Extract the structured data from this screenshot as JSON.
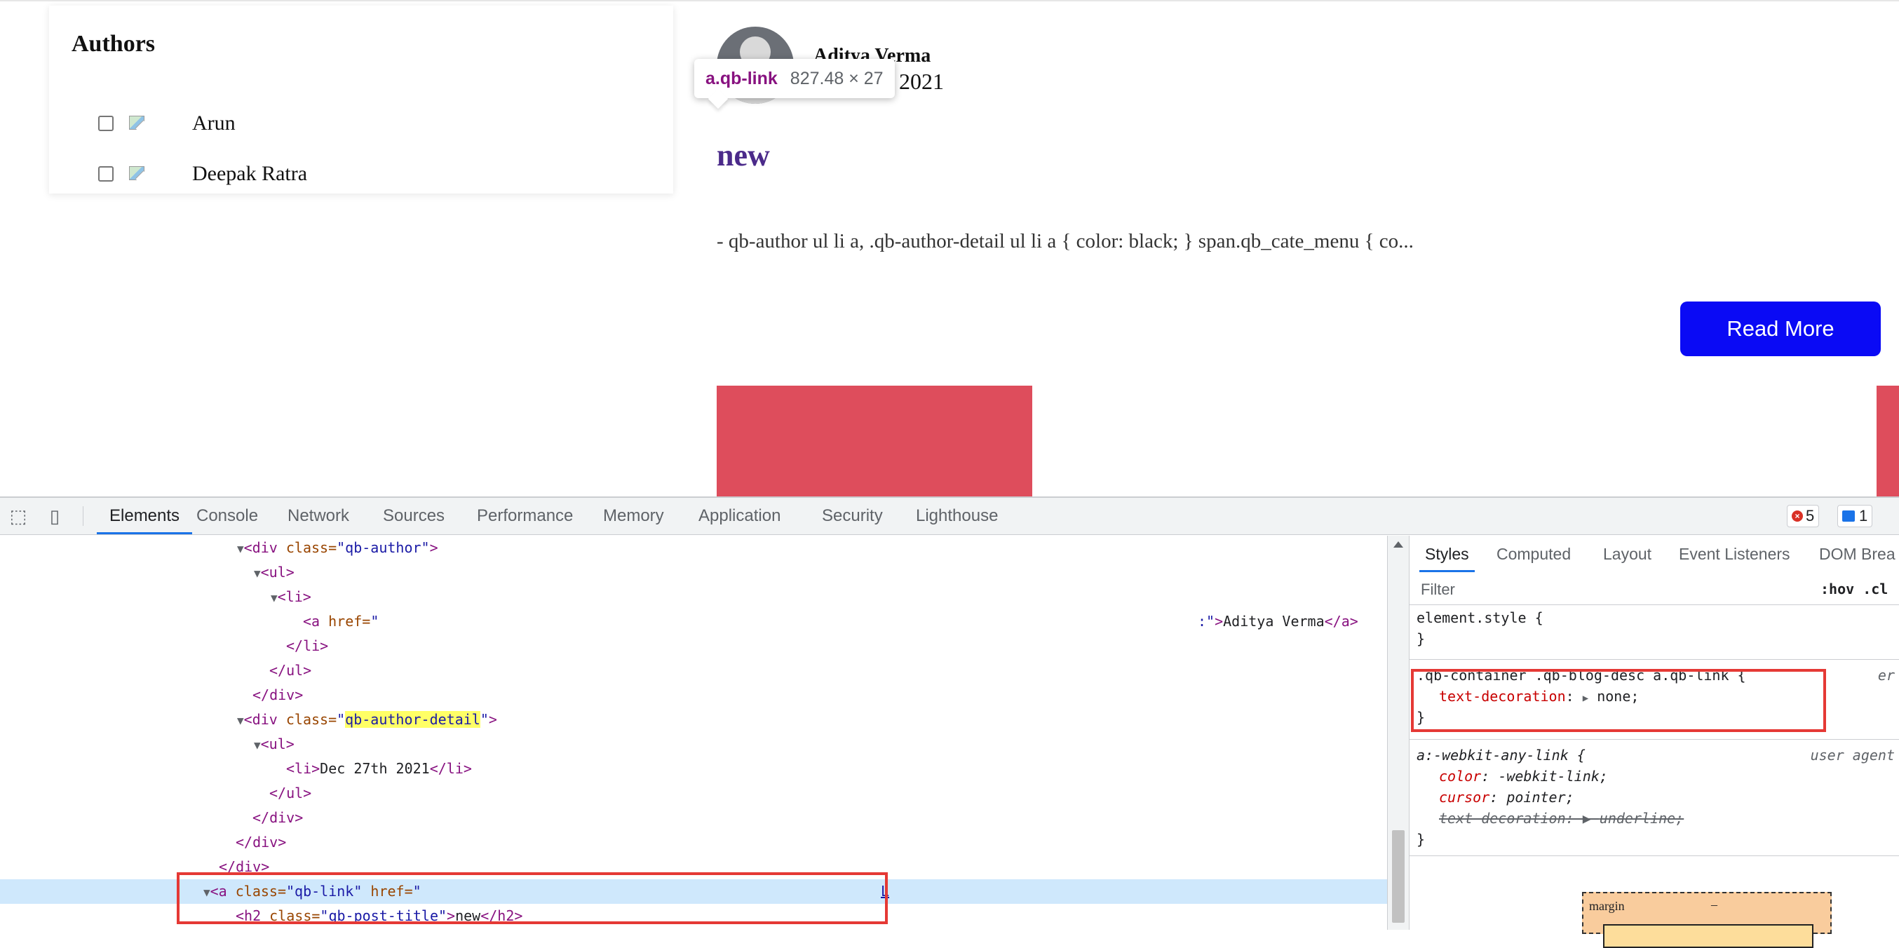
{
  "page": {
    "authors_title": "Authors",
    "authors": [
      {
        "name": "Arun"
      },
      {
        "name": "Deepak Ratra"
      }
    ],
    "post": {
      "author": "Aditya Verma",
      "date_fragment": "2021",
      "title": "new",
      "excerpt": "- qb-author ul li a, .qb-author-detail ul li a { color: black; } span.qb_cate_menu { co...",
      "read_more_label": "Read More",
      "thumb_color": "#de4d5c"
    },
    "tooltip": {
      "selector": "a.qb-link",
      "dimensions": "827.48 × 27"
    }
  },
  "devtools": {
    "tabs": [
      "Elements",
      "Console",
      "Network",
      "Sources",
      "Performance",
      "Memory",
      "Application",
      "Security",
      "Lighthouse"
    ],
    "active_tab": "Elements",
    "errors_count": "5",
    "messages_count": "1",
    "dom": {
      "l1_tag_open": "<div ",
      "l1_attr": "class=",
      "l1_val": "\"qb-author\"",
      "l1_close": ">",
      "l2": "<ul>",
      "l3": "<li>",
      "l4_tag": "<a ",
      "l4_attr": "href=",
      "l4_val": "\"",
      "l4_tail_val": ":\"",
      "l4_tail_close": ">",
      "l4_text": "Aditya Verma",
      "l4_end": "</a>",
      "l5": "</li>",
      "l6": "</ul>",
      "l7": "</div>",
      "l8_tag_open": "<div ",
      "l8_attr": "class=",
      "l8_val_q1": "\"",
      "l8_val_hl": "qb-author-detail",
      "l8_val_q2": "\"",
      "l8_close": ">",
      "l9": "<ul>",
      "l10_open": "<li>",
      "l10_text": "Dec 27th 2021",
      "l10_close": "</li>",
      "l11": "</ul>",
      "l12": "</div>",
      "l13": "</div>",
      "l14": "</div>",
      "l15_tag": "<a ",
      "l15_attr1": "class=",
      "l15_val1": "\"qb-link\"",
      "l15_attr2": " href=",
      "l15_val2": "\"",
      "l15_tail": "L",
      "l16_tag": "<h2 ",
      "l16_attr": "class=",
      "l16_val": "\"qb-post-title\"",
      "l16_close": ">",
      "l16_text": "new",
      "l16_end": "</h2>"
    },
    "styles": {
      "tabs": [
        "Styles",
        "Computed",
        "Layout",
        "Event Listeners",
        "DOM Brea"
      ],
      "active_tab": "Styles",
      "filter_placeholder": "Filter",
      "filter_options": ":hov .cl",
      "element_style_open": "element.style {",
      "close_brace": "}",
      "rule1_selector": ".qb-container .qb-blog-desc a.qb-link {",
      "rule1_source": "er",
      "rule1_prop": "text-decoration",
      "rule1_value": "none;",
      "rule2_selector": "a:-webkit-any-link {",
      "rule2_source": "user agent",
      "rule2_props": [
        {
          "name": "color",
          "value": "-webkit-link;"
        },
        {
          "name": "cursor",
          "value": "pointer;"
        },
        {
          "name": "text-decoration",
          "value": "underline;"
        }
      ],
      "boxmodel_label": "margin",
      "boxmodel_value": "–"
    },
    "highlight_color": "#e53935"
  }
}
